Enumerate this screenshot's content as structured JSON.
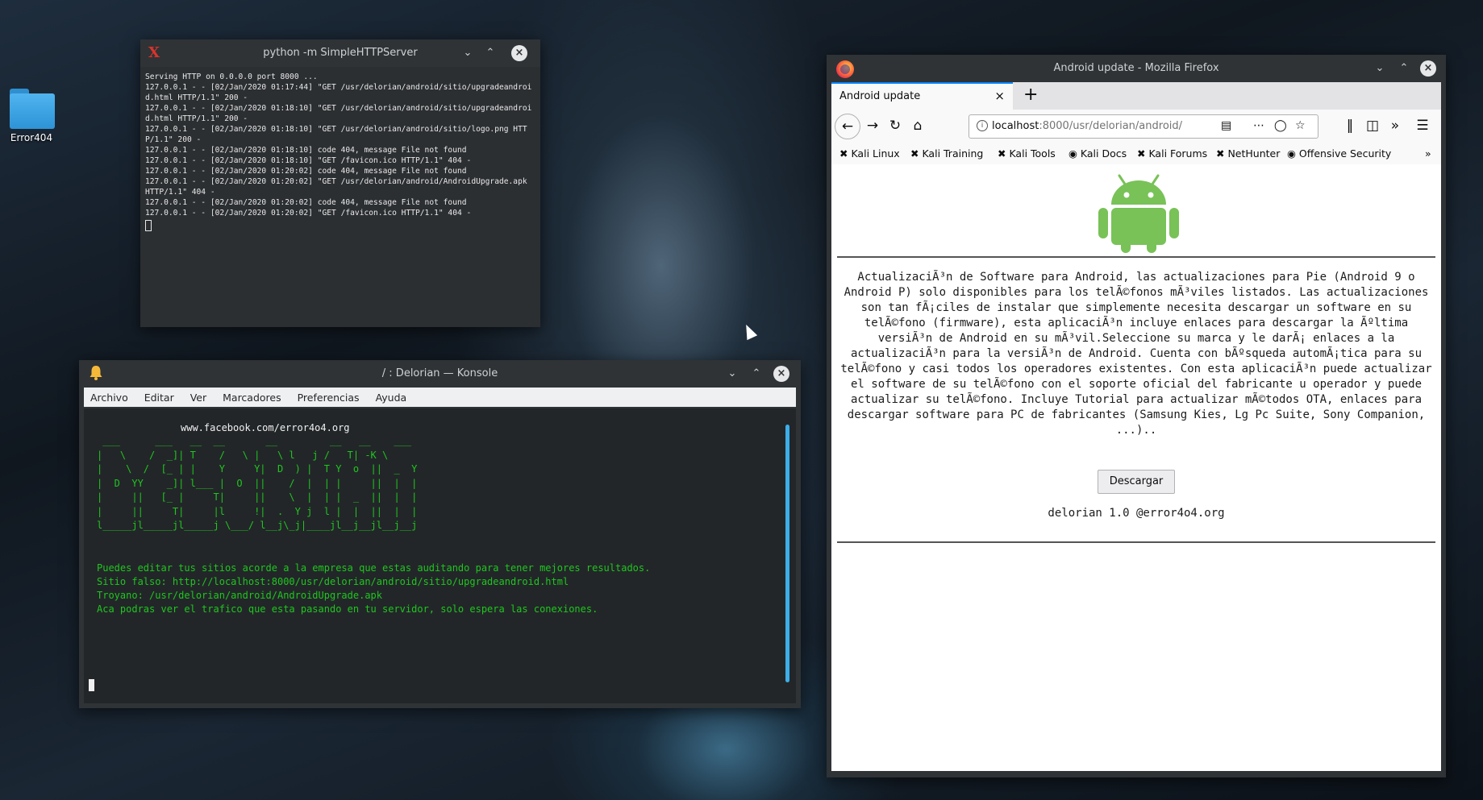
{
  "desktop": {
    "icon_label": "Error404"
  },
  "python_window": {
    "title": "python -m SimpleHTTPServer",
    "lines": [
      "Serving HTTP on 0.0.0.0 port 8000 ...",
      "127.0.0.1 - - [02/Jan/2020 01:17:44] \"GET /usr/delorian/android/sitio/upgradeandroid.html HTTP/1.1\" 200 -",
      "127.0.0.1 - - [02/Jan/2020 01:18:10] \"GET /usr/delorian/android/sitio/upgradeandroid.html HTTP/1.1\" 200 -",
      "127.0.0.1 - - [02/Jan/2020 01:18:10] \"GET /usr/delorian/android/sitio/logo.png HTTP/1.1\" 200 -",
      "127.0.0.1 - - [02/Jan/2020 01:18:10] code 404, message File not found",
      "127.0.0.1 - - [02/Jan/2020 01:18:10] \"GET /favicon.ico HTTP/1.1\" 404 -",
      "127.0.0.1 - - [02/Jan/2020 01:20:02] code 404, message File not found",
      "127.0.0.1 - - [02/Jan/2020 01:20:02] \"GET /usr/delorian/android/AndroidUpgrade.apk HTTP/1.1\" 404 -",
      "127.0.0.1 - - [02/Jan/2020 01:20:02] code 404, message File not found",
      "127.0.0.1 - - [02/Jan/2020 01:20:02] \"GET /favicon.ico HTTP/1.1\" 404 -"
    ]
  },
  "konsole": {
    "title": "/ : Delorian — Konsole",
    "menu": [
      "Archivo",
      "Editar",
      "Ver",
      "Marcadores",
      "Preferencias",
      "Ayuda"
    ],
    "header": "www.facebook.com/error4o4.org",
    "ascii_art": " ___      ___   __  __       __         __   __    ___\n|   \\    /  _]| T    /   \\ |   \\ l   j /   T| -K \\\n|    \\  /  [_ | |    Y     Y|  D  ) |  T Y  o  ||  _  Y\n|  D  YY    _]| l___ |  O  ||    /  |  | |     ||  |  |\n|     ||   [_ |     T|     ||    \\  |  | |  _  ||  |  |\n|     ||     T|     |l     !|  .  Y j  l |  |  ||  |  |\nl_____jl_____jl_____j \\___/ l__j\\_j|____jl__j__jl__j__j",
    "lines": [
      "Puedes editar tus sitios acorde a la empresa que estas auditando para tener mejores resultados.",
      "Sitio falso: http://localhost:8000/usr/delorian/android/sitio/upgradeandroid.html",
      "Troyano: /usr/delorian/android/AndroidUpgrade.apk",
      "Aca podras ver el trafico que esta pasando en tu servidor, solo espera las conexiones."
    ]
  },
  "firefox": {
    "title": "Android update - Mozilla Firefox",
    "tab_label": "Android update",
    "url_host": "localhost",
    "url_rest": ":8000/usr/delorian/android/",
    "bookmarks": [
      "Kali Linux",
      "Kali Training",
      "Kali Tools",
      "Kali Docs",
      "Kali Forums",
      "NetHunter",
      "Offensive Security"
    ],
    "page": {
      "description": "ActualizaciÃ³n de Software para Android, las actualizaciones para Pie (Android 9 o Android P) solo disponibles para los telÃ©fonos mÃ³viles listados. Las actualizaciones son tan fÃ¡ciles de instalar que simplemente necesita descargar un software en su telÃ©fono (firmware), esta aplicaciÃ³n incluye enlaces para descargar la Ãºltima versiÃ³n de Android en su mÃ³vil.Seleccione su marca y le darÃ¡ enlaces a la actualizaciÃ³n para la versiÃ³n de Android. Cuenta con bÃºsqueda automÃ¡tica para su telÃ©fono y casi todos los operadores existentes. Con esta aplicaciÃ³n puede actualizar el software de su telÃ©fono con el soporte oficial del fabricante u operador y puede actualizar su telÃ©fono. Incluye Tutorial para actualizar mÃ©todos OTA, enlaces para descargar software para PC de fabricantes (Samsung Kies, Lg Pc Suite, Sony Companion, ...)..",
      "button": "Descargar",
      "footer": "delorian 1.0 @error4o4.org"
    }
  },
  "colors": {
    "android_green": "#78c257",
    "terminal_green": "#1ec71e",
    "kde_blue": "#3daee9"
  }
}
